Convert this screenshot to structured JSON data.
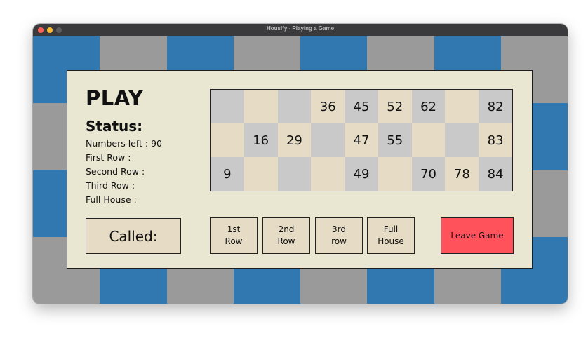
{
  "window": {
    "title": "Housify - Playing a Game"
  },
  "colors": {
    "blue": "#3177b0",
    "gray": "#9a9a9a",
    "panel": "#e9e6d2",
    "cell_gray": "#c9c9c9",
    "cell_tan": "#e6dcc5",
    "leave": "#ff525a"
  },
  "game": {
    "heading": "PLAY",
    "status_heading": "Status:",
    "status_lines": [
      "Numbers left : 90",
      "First Row :",
      "Second Row :",
      "Third Row :",
      "Full House :"
    ]
  },
  "ticket": [
    [
      "",
      "",
      "",
      "36",
      "45",
      "52",
      "62",
      "",
      "82"
    ],
    [
      "",
      "16",
      "29",
      "",
      "47",
      "55",
      "",
      "",
      "83"
    ],
    [
      "9",
      "",
      "",
      "",
      "49",
      "",
      "70",
      "78",
      "84"
    ]
  ],
  "buttons": {
    "called": "Called:",
    "first_row": "1st\nRow",
    "second_row": "2nd\nRow",
    "third_row": "3rd\nrow",
    "full_house": "Full\nHouse",
    "leave": "Leave Game"
  }
}
